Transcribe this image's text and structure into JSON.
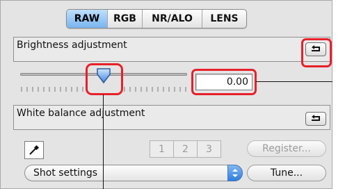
{
  "tabs": [
    {
      "label": "RAW",
      "active": true
    },
    {
      "label": "RGB",
      "active": false
    },
    {
      "label": "NR/ALO",
      "active": false
    },
    {
      "label": "LENS",
      "active": false
    }
  ],
  "brightness": {
    "title": "Brightness adjustment",
    "value": "0.00",
    "slider_fraction": 0.5
  },
  "white_balance": {
    "title": "White balance adjustment",
    "presets": [
      "1",
      "2",
      "3"
    ],
    "register_label": "Register...",
    "select_value": "Shot settings",
    "tune_label": "Tune..."
  },
  "colors": {
    "accent": "#78b4ee",
    "highlight": "#e8202a",
    "panel_bg": "#e4e4e4"
  },
  "icons": [
    "reset-icon",
    "slider-thumb-icon",
    "eyedropper-icon",
    "select-arrows-icon"
  ]
}
